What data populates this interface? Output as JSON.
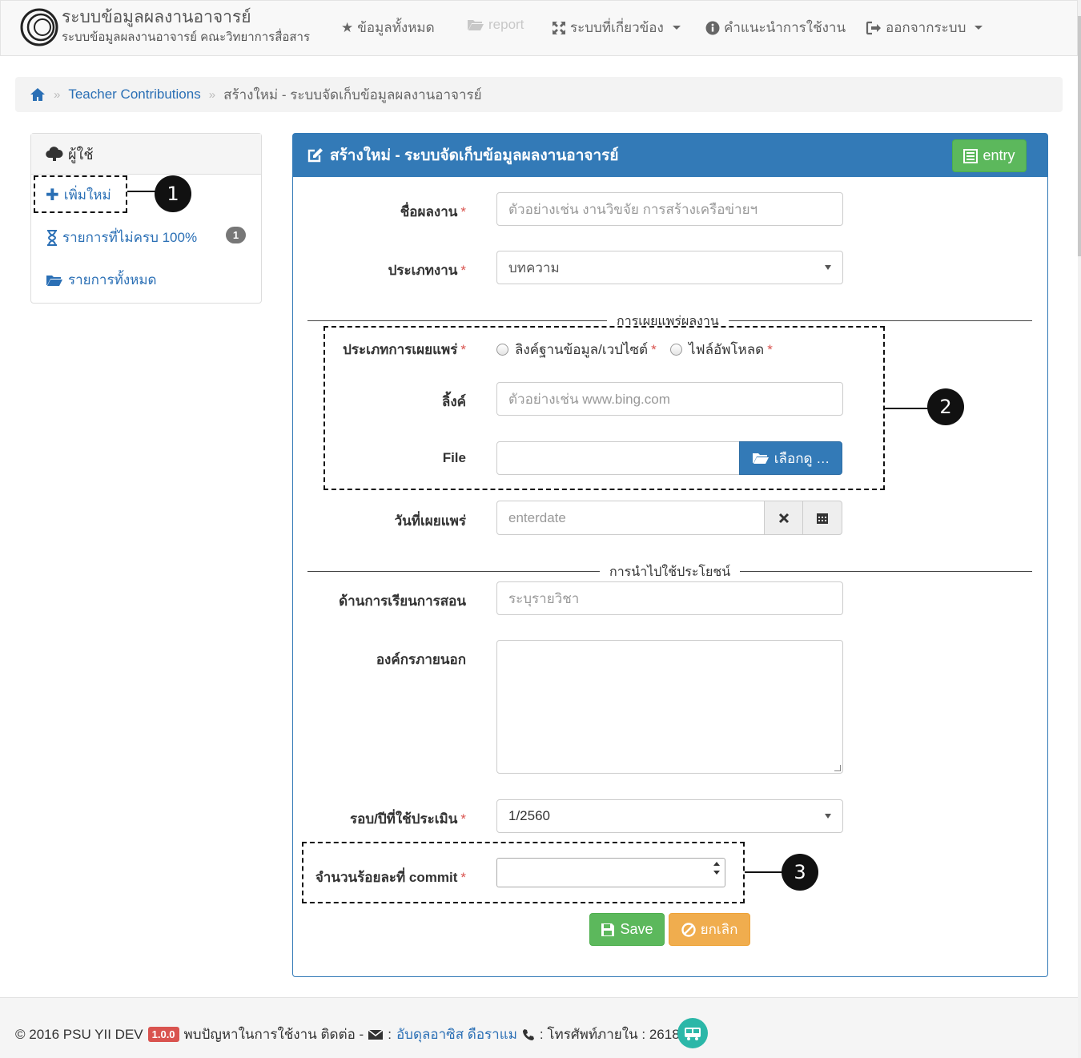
{
  "navbar": {
    "brand_title": "ระบบข้อมูลผลงานอาจารย์",
    "brand_subtitle": "ระบบข้อมูลผลงานอาจารย์ คณะวิทยาการสื่อสาร",
    "items": [
      {
        "label": "ข้อมูลทั้งหมด",
        "icon": "star-icon"
      },
      {
        "label": "report",
        "icon": "folder-open-icon",
        "disabled": true
      },
      {
        "label": "ระบบที่เกี่ยวข้อง",
        "icon": "fullscreen-icon",
        "dropdown": true
      },
      {
        "label": "คำแนะนำการใช้งาน",
        "icon": "info-icon"
      },
      {
        "label": "ออกจากระบบ",
        "icon": "logout-icon",
        "dropdown": true
      }
    ]
  },
  "breadcrumb": {
    "home_icon": "home-icon",
    "items": [
      "Teacher Contributions",
      "สร้างใหม่ - ระบบจัดเก็บข้อมูลผลงานอาจารย์"
    ]
  },
  "sidebar": {
    "title": "ผู้ใช้",
    "items": [
      {
        "label": "เพิ่มใหม่",
        "icon": "plus-icon"
      },
      {
        "label": "รายการที่ไม่ครบ 100%",
        "icon": "hourglass-icon",
        "badge": "1"
      },
      {
        "label": "รายการทั้งหมด",
        "icon": "folder-open-icon"
      }
    ]
  },
  "panel": {
    "title": "สร้างใหม่ - ระบบจัดเก็บข้อมูลผลงานอาจารย์",
    "entry_label": "entry"
  },
  "form": {
    "work_name": {
      "label": "ชื่อผลงาน",
      "placeholder": "ตัวอย่างเช่น  งานวิขจัย การสร้างเครือข่ายฯ"
    },
    "work_type": {
      "label": "ประเภทงาน",
      "value": "บทความ"
    },
    "legend_publish": "การเผยแพร่ผลงาน",
    "publish_type": {
      "label": "ประเภทการเผยแพร่",
      "option_link": "ลิงค์ฐานข้อมูล/เวปไซต์",
      "option_file": "ไฟล์อัพโหลด"
    },
    "link": {
      "label": "ลิ้งค์",
      "placeholder": "ตัวอย่างเช่น  www.bing.com"
    },
    "file": {
      "label": "File",
      "browse_label": "เลือกดู …"
    },
    "publish_date": {
      "label": "วันที่เผยแพร่",
      "placeholder": "enterdate"
    },
    "legend_benefit": "การนำไปใช้ประโยชน์",
    "teaching": {
      "label": "ด้านการเรียนการสอน",
      "placeholder": "ระบุรายวิชา"
    },
    "external_org": {
      "label": "องค์กรภายนอก"
    },
    "eval_round": {
      "label": "รอบ/ปีที่ใช้ประเมิน",
      "value": "1/2560"
    },
    "commit_percent": {
      "label": "จำนวนร้อยละที่ commit"
    },
    "required_mark": "*",
    "save_label": "Save",
    "cancel_label": "ยกเลิก"
  },
  "callouts": [
    "1",
    "2",
    "3"
  ],
  "footer": {
    "copyright": "© 2016 PSU YII DEV",
    "version": "1.0.0",
    "contact_text": "พบปัญหาในการใช้งาน ติดต่อ -",
    "contact_name": "อับดุลอาซิส ดือราแม",
    "phone_text": ": โทรศัพท์ภายใน : 2618"
  },
  "colors": {
    "primary": "#337ab7",
    "success": "#5cb85c",
    "warning": "#f0ad4e",
    "danger": "#d9534f",
    "link": "#2a6fb5"
  }
}
